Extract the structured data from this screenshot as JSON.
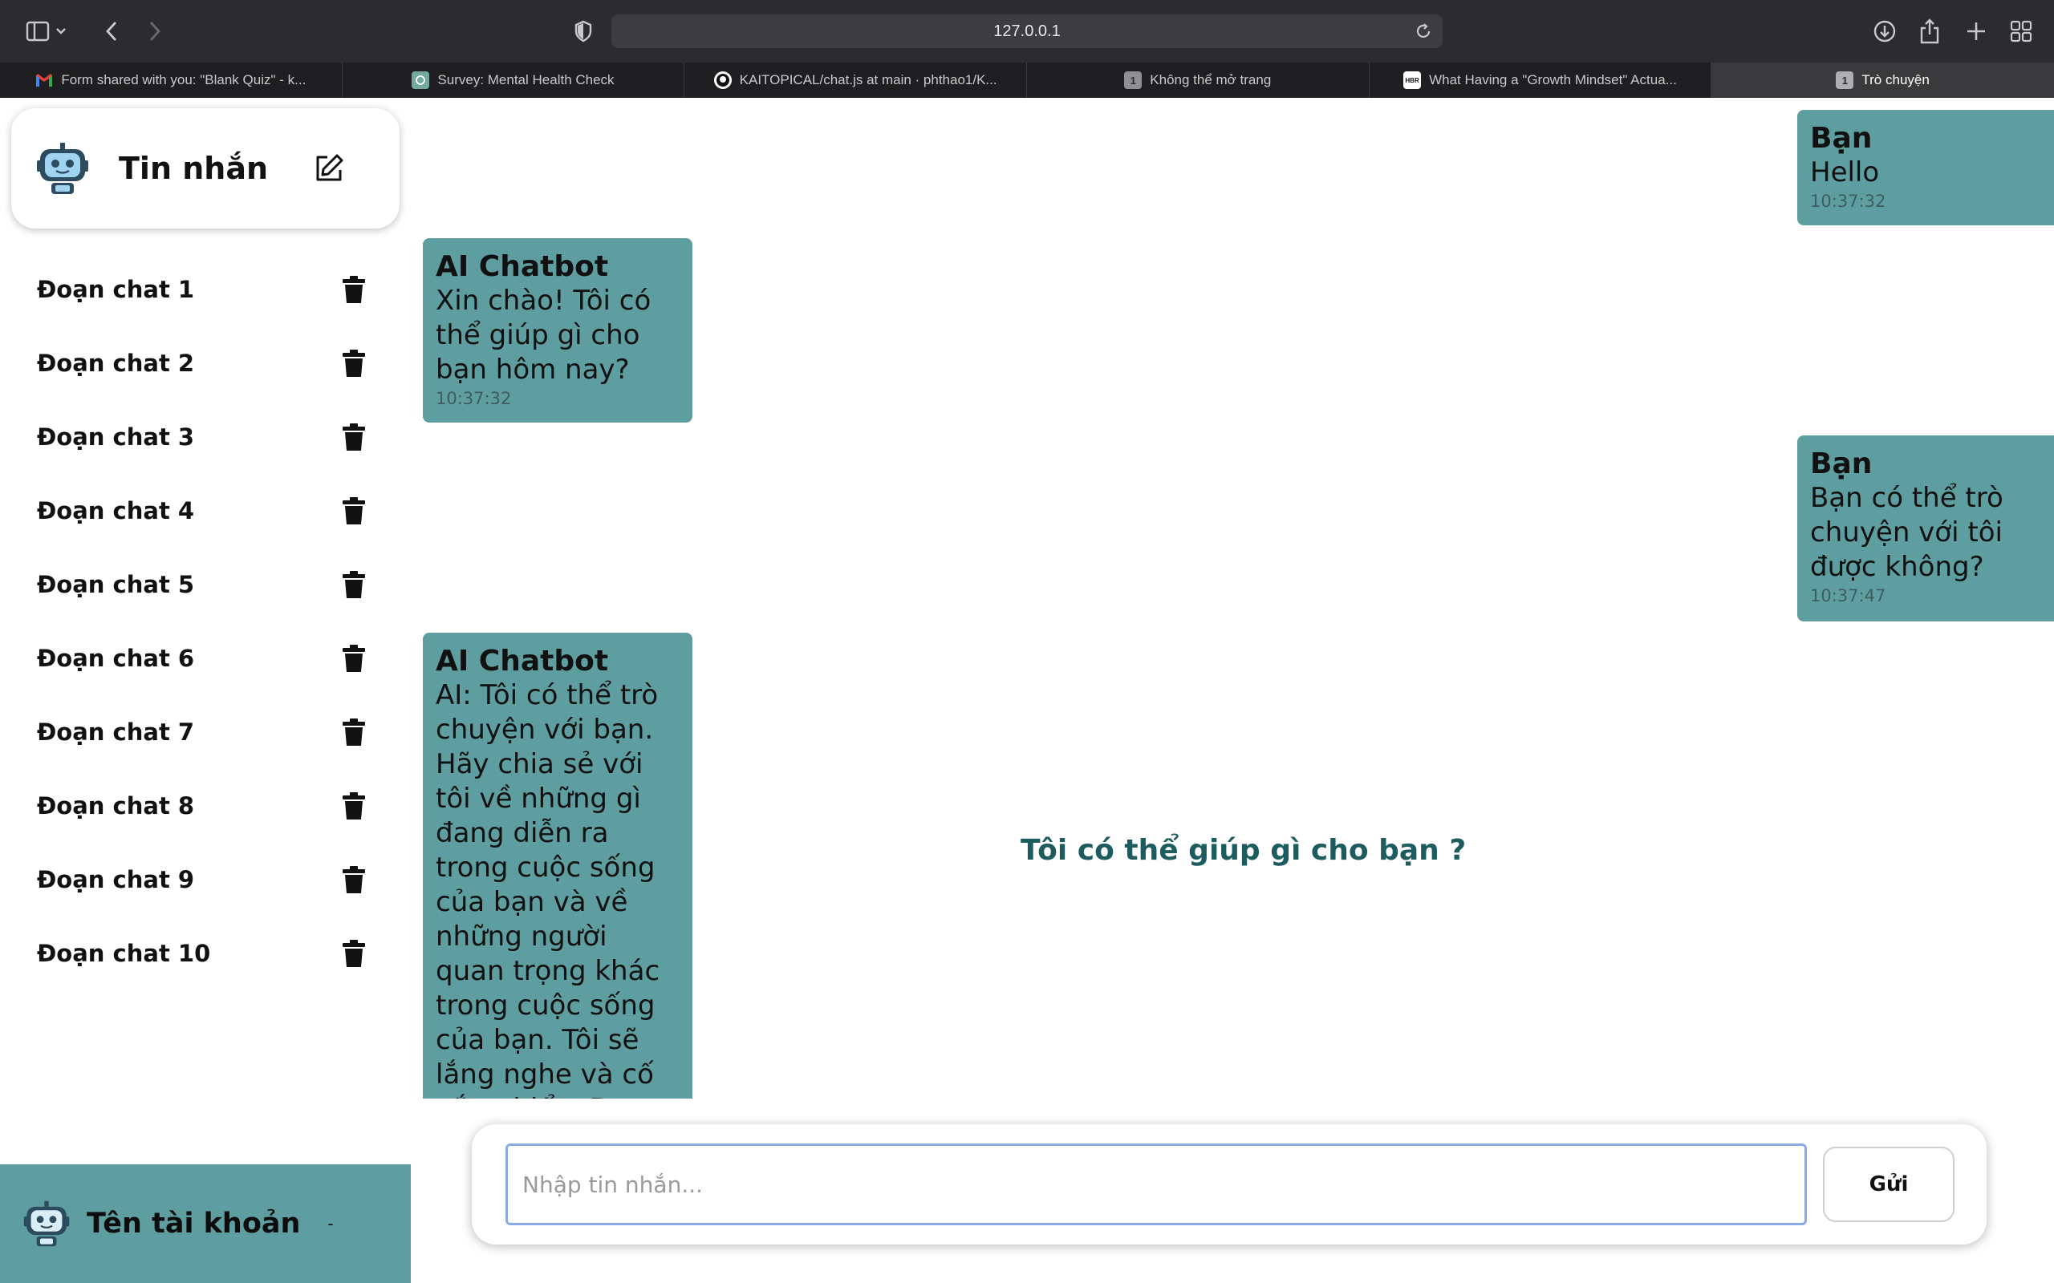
{
  "browser": {
    "url": "127.0.0.1",
    "tabs": [
      {
        "label": "Form shared with you: \"Blank Quiz\" - k...",
        "favicon": "gmail-icon",
        "active": false
      },
      {
        "label": "Survey: Mental Health Check",
        "favicon": "openai-icon",
        "active": false
      },
      {
        "label": "KAITOPICAL/chat.js at main · phthao1/K...",
        "favicon": "github-icon",
        "active": false
      },
      {
        "label": "Không thể mở trang",
        "favicon": "number-1-icon",
        "active": false
      },
      {
        "label": "What Having a \"Growth Mindset\" Actua...",
        "favicon": "hbr-icon",
        "active": false
      },
      {
        "label": "Trò chuyện",
        "favicon": "number-1-icon",
        "active": true
      }
    ]
  },
  "sidebar": {
    "title": "Tin nhắn",
    "chats": [
      {
        "label": "Đoạn chat 1"
      },
      {
        "label": "Đoạn chat 2"
      },
      {
        "label": "Đoạn chat 3"
      },
      {
        "label": "Đoạn chat 4"
      },
      {
        "label": "Đoạn chat 5"
      },
      {
        "label": "Đoạn chat 6"
      },
      {
        "label": "Đoạn chat 7"
      },
      {
        "label": "Đoạn chat 8"
      },
      {
        "label": "Đoạn chat 9"
      },
      {
        "label": "Đoạn chat 10"
      }
    ],
    "account": {
      "name": "Tên tài khoản",
      "caret": "-"
    }
  },
  "messages": [
    {
      "sender": "Bạn",
      "text": "Hello",
      "time": "10:37:32",
      "side": "right"
    },
    {
      "sender": "AI Chatbot",
      "text": "Xin chào! Tôi có thể giúp gì cho bạn hôm nay?",
      "time": "10:37:32",
      "side": "left"
    },
    {
      "sender": "Bạn",
      "text": "Bạn có thể trò chuyện với tôi được không?",
      "time": "10:37:47",
      "side": "right"
    },
    {
      "sender": "AI Chatbot",
      "text": "AI: Tôi có thể trò chuyện với bạn. Hãy chia sẻ với tôi về những gì đang diễn ra trong cuộc sống của bạn và về những người quan trọng khác trong cuộc sống của bạn. Tôi sẽ lắng nghe và cố gắng hiểu. Bạn có",
      "time": "",
      "side": "left"
    }
  ],
  "center_hint": "Tôi có thể giúp gì cho bạn ?",
  "composer": {
    "placeholder": "Nhập tin nhắn...",
    "value": "",
    "send_label": "Gửi"
  },
  "colors": {
    "accent": "#5f9ea0",
    "hint": "#1d5c5e",
    "chrome": "#2c2c2e"
  }
}
